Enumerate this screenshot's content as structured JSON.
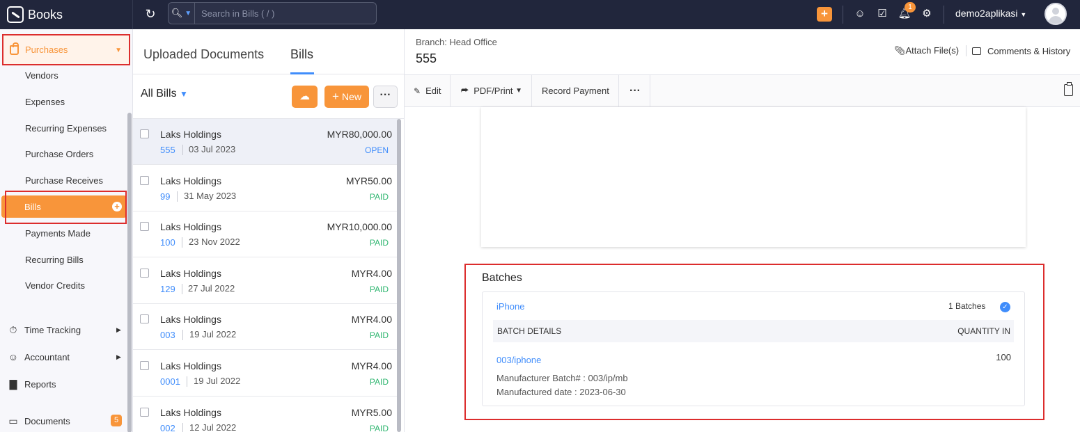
{
  "app": {
    "name": "Books"
  },
  "search": {
    "placeholder": "Search in Bills ( / )"
  },
  "topbar": {
    "org_name": "demo2aplikasi",
    "notification_count": "1"
  },
  "sidebar": {
    "parent": "Purchases",
    "items": [
      {
        "label": "Vendors"
      },
      {
        "label": "Expenses"
      },
      {
        "label": "Recurring Expenses"
      },
      {
        "label": "Purchase Orders"
      },
      {
        "label": "Purchase Receives"
      },
      {
        "label": "Bills"
      },
      {
        "label": "Payments Made"
      },
      {
        "label": "Recurring Bills"
      },
      {
        "label": "Vendor Credits"
      }
    ],
    "groups": [
      {
        "label": "Time Tracking"
      },
      {
        "label": "Accountant"
      },
      {
        "label": "Reports"
      },
      {
        "label": "Documents",
        "badge": "5"
      }
    ]
  },
  "list": {
    "tabs": [
      {
        "label": "Uploaded Documents"
      },
      {
        "label": "Bills"
      }
    ],
    "view": "All Bills",
    "new_label": "New",
    "rows": [
      {
        "vendor": "Laks Holdings",
        "amount": "MYR80,000.00",
        "number": "555",
        "date": "03 Jul 2023",
        "status": "OPEN"
      },
      {
        "vendor": "Laks Holdings",
        "amount": "MYR50.00",
        "number": "99",
        "date": "31 May 2023",
        "status": "PAID"
      },
      {
        "vendor": "Laks Holdings",
        "amount": "MYR10,000.00",
        "number": "100",
        "date": "23 Nov 2022",
        "status": "PAID"
      },
      {
        "vendor": "Laks Holdings",
        "amount": "MYR4.00",
        "number": "129",
        "date": "27 Jul 2022",
        "status": "PAID"
      },
      {
        "vendor": "Laks Holdings",
        "amount": "MYR4.00",
        "number": "003",
        "date": "19 Jul 2022",
        "status": "PAID"
      },
      {
        "vendor": "Laks Holdings",
        "amount": "MYR4.00",
        "number": "0001",
        "date": "19 Jul 2022",
        "status": "PAID"
      },
      {
        "vendor": "Laks Holdings",
        "amount": "MYR5.00",
        "number": "002",
        "date": "12 Jul 2022",
        "status": "PAID"
      }
    ]
  },
  "detail": {
    "branch": "Branch: Head Office",
    "title": "555",
    "attach": "Attach File(s)",
    "comments": "Comments & History",
    "toolbar": {
      "edit": "Edit",
      "pdf": "PDF/Print",
      "record": "Record Payment"
    },
    "batches": {
      "title": "Batches",
      "item": "iPhone",
      "count": "1 Batches",
      "col_details": "BATCH DETAILS",
      "col_qty": "QUANTITY IN",
      "batch_no": "003/iphone",
      "qty": "100",
      "mfg_batch": "Manufacturer Batch# : 003/ip/mb",
      "mfg_date": "Manufactured date : 2023-06-30"
    }
  },
  "colors": {
    "accent": "#f8953a",
    "link": "#408dfb",
    "paid": "#2fb670",
    "topbar": "#21263c",
    "highlight": "#dc2d2d"
  }
}
